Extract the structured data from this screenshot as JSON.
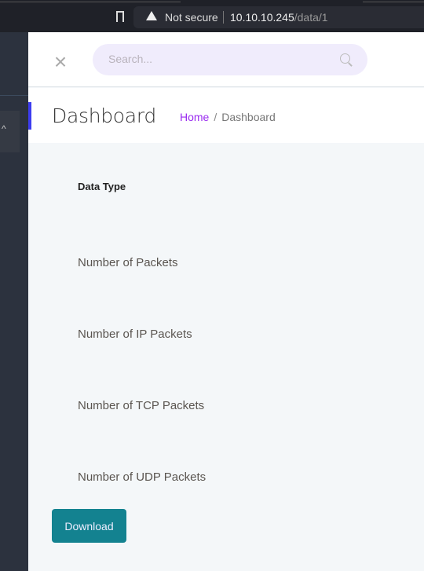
{
  "browser": {
    "security_label": "Not secure",
    "url_host": "10.10.10.245",
    "url_path": "/data/1"
  },
  "search": {
    "placeholder": "Search..."
  },
  "header": {
    "title": "Dashboard",
    "breadcrumb": {
      "home": "Home",
      "separator": "/",
      "current": "Dashboard"
    }
  },
  "table": {
    "header": "Data Type",
    "rows": [
      "Number of Packets",
      "Number of IP Packets",
      "Number of TCP Packets",
      "Number of UDP Packets"
    ]
  },
  "actions": {
    "download_label": "Download"
  },
  "sidebar": {
    "collapse_icon": "^"
  }
}
